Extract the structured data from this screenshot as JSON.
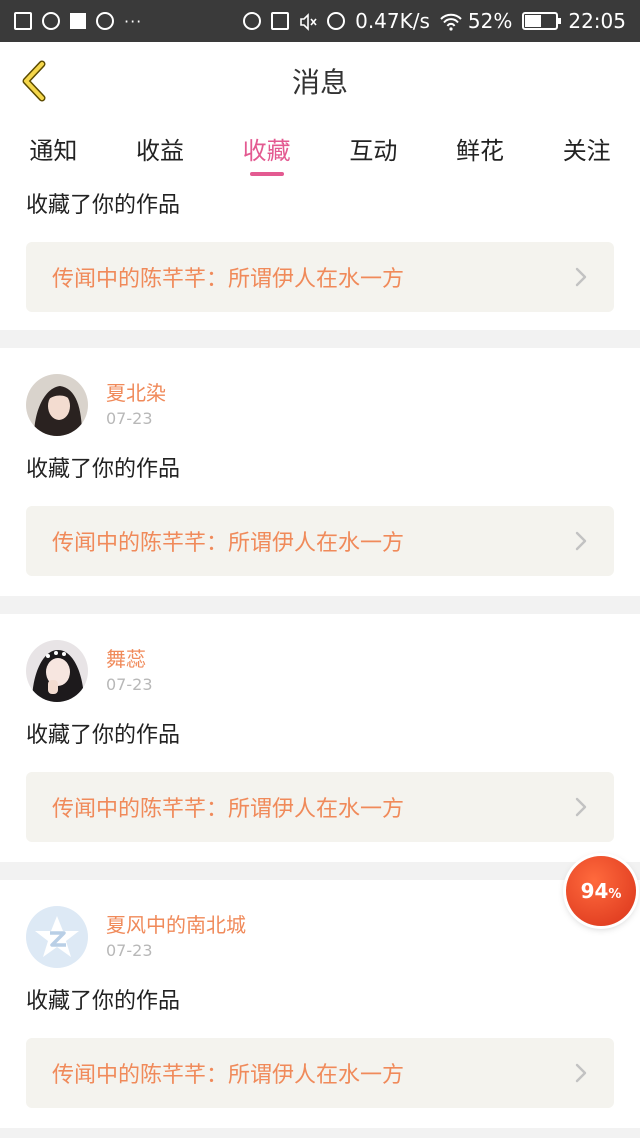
{
  "status_bar": {
    "net_speed": "0.47K/s",
    "battery_pct": "52%",
    "battery_level": 0.52,
    "time": "22:05",
    "dots": "···"
  },
  "nav": {
    "title": "消息"
  },
  "tabs": [
    {
      "label": "通知"
    },
    {
      "label": "收益"
    },
    {
      "label": "收藏",
      "active": true
    },
    {
      "label": "互动"
    },
    {
      "label": "鲜花"
    },
    {
      "label": "关注"
    }
  ],
  "items": [
    {
      "action": "收藏了你的作品",
      "work": "传闻中的陈芊芊：所谓伊人在水一方"
    },
    {
      "name": "夏北染",
      "date": "07-23",
      "action": "收藏了你的作品",
      "work": "传闻中的陈芊芊：所谓伊人在水一方"
    },
    {
      "name": "舞蕊",
      "date": "07-23",
      "action": "收藏了你的作品",
      "work": "传闻中的陈芊芊：所谓伊人在水一方"
    },
    {
      "name": "夏风中的南北城",
      "date": "07-23",
      "action": "收藏了你的作品",
      "work": "传闻中的陈芊芊：所谓伊人在水一方"
    }
  ],
  "floating_badge": {
    "value": "94",
    "unit": "%"
  },
  "colors": {
    "accent": "#e35a91",
    "name": "#f08a5a",
    "date": "#b8b8b8"
  }
}
